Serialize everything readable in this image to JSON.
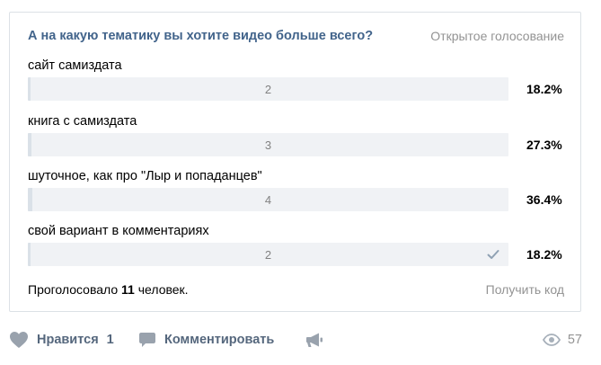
{
  "poll": {
    "question": "А на какую тематику вы хотите видео больше всего?",
    "type_label": "Открытое голосование",
    "options": [
      {
        "label": "сайт самиздата",
        "count": "2",
        "percent": "18.2%",
        "fraction": 0.182,
        "selected": false
      },
      {
        "label": "книга с самиздата",
        "count": "3",
        "percent": "27.3%",
        "fraction": 0.273,
        "selected": false
      },
      {
        "label": "шуточное, как про \"Лыр и попаданцев\"",
        "count": "4",
        "percent": "36.4%",
        "fraction": 0.364,
        "selected": false
      },
      {
        "label": "свой вариант в комментариях",
        "count": "2",
        "percent": "18.2%",
        "fraction": 0.182,
        "selected": true
      }
    ],
    "voted_prefix": "Проголосовало ",
    "voted_count": "11",
    "voted_suffix": " человек.",
    "get_code_label": "Получить код"
  },
  "actions": {
    "like_label": "Нравится",
    "like_count": "1",
    "comment_label": "Комментировать",
    "views_count": "57"
  },
  "icons": {
    "like": "heart-icon",
    "comment": "comment-icon",
    "share": "megaphone-icon",
    "views": "eye-icon",
    "selected": "checkmark-icon"
  },
  "colors": {
    "question": "#42648b",
    "bar_track": "#f0f2f5",
    "bar_fill": "#dae1e8",
    "muted_text": "#939393",
    "action_text": "#55677d",
    "action_icon": "#99a2ad",
    "check": "#8fa1b3"
  }
}
